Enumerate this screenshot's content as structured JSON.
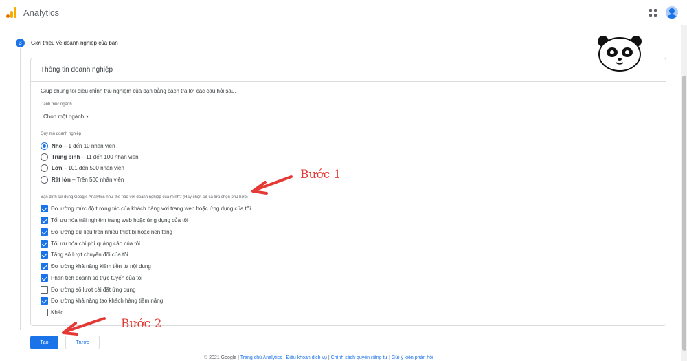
{
  "header": {
    "app_title": "Analytics",
    "apps_icon": "apps-grid-icon",
    "avatar_icon": "account-avatar-icon"
  },
  "step": {
    "number": "3",
    "title": "Giới thiệu về doanh nghiệp của bạn"
  },
  "card": {
    "title": "Thông tin doanh nghiệp",
    "intro": "Giúp chúng tôi điều chỉnh trải nghiệm của bạn bằng cách trả lời các câu hỏi sau.",
    "industry_label": "Danh mục ngành",
    "industry_value": "Chọn một ngành",
    "size_label": "Quy mô doanh nghiệp",
    "sizes": [
      {
        "name": "Nhỏ",
        "desc": " – 1 đến 10 nhân viên",
        "selected": true
      },
      {
        "name": "Trung bình",
        "desc": " – 11 đến 100 nhân viên",
        "selected": false
      },
      {
        "name": "Lớn",
        "desc": " – 101 đến 500 nhân viên",
        "selected": false
      },
      {
        "name": "Rất lớn",
        "desc": " – Trên 500 nhân viên",
        "selected": false
      }
    ],
    "usage_label": "Bạn định sử dụng Google Analytics như thế nào với doanh nghiệp của mình? (Hãy chọn tất cả lựa chọn phù hợp)",
    "usages": [
      {
        "label": "Đo lường mức độ tương tác của khách hàng với trang web hoặc ứng dụng của tôi",
        "checked": true
      },
      {
        "label": "Tối ưu hóa trải nghiệm trang web hoặc ứng dụng của tôi",
        "checked": true
      },
      {
        "label": "Đo lường dữ liệu trên nhiều thiết bị hoặc nền tảng",
        "checked": true
      },
      {
        "label": "Tối ưu hóa chi phí quảng cáo của tôi",
        "checked": true
      },
      {
        "label": "Tăng số lượt chuyển đổi của tôi",
        "checked": true
      },
      {
        "label": "Đo lường khả năng kiếm tiền từ nội dung",
        "checked": true
      },
      {
        "label": "Phân tích doanh số trực tuyến của tôi",
        "checked": true
      },
      {
        "label": "Đo lường số lượt cài đặt ứng dụng",
        "checked": false
      },
      {
        "label": "Đo lường khả năng tạo khách hàng tiềm năng",
        "checked": true
      },
      {
        "label": "Khác",
        "checked": false
      }
    ]
  },
  "buttons": {
    "create": "Tạo",
    "previous": "Trước"
  },
  "footer": {
    "copyright": "© 2021 Google",
    "links": [
      "Trang chủ Analytics",
      "Điều khoản dịch vụ",
      "Chính sách quyền riêng tư",
      "Gửi ý kiến phản hồi"
    ]
  },
  "annotations": {
    "step1": "Bước 1",
    "step2": "Bước 2",
    "color": "#e53935"
  },
  "colors": {
    "accent": "#1a73e8",
    "logo_orange": "#e37400",
    "logo_yellow": "#f9ab00"
  }
}
